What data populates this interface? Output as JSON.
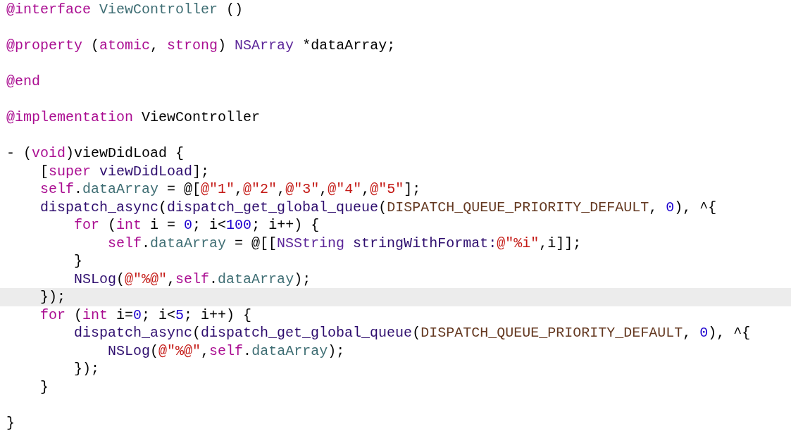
{
  "editor": {
    "lines": [
      {
        "highlighted": false,
        "tokens": [
          {
            "kind": "keyword",
            "text": "@interface"
          },
          {
            "kind": "project",
            "text": " ViewController"
          },
          {
            "kind": "plain",
            "text": " ()"
          }
        ]
      },
      {
        "highlighted": false
      },
      {
        "highlighted": false,
        "tokens": [
          {
            "kind": "keyword",
            "text": "@property"
          },
          {
            "kind": "plain",
            "text": " ("
          },
          {
            "kind": "keyword",
            "text": "atomic"
          },
          {
            "kind": "plain",
            "text": ", "
          },
          {
            "kind": "keyword",
            "text": "strong"
          },
          {
            "kind": "plain",
            "text": ") "
          },
          {
            "kind": "class",
            "text": "NSArray"
          },
          {
            "kind": "plain",
            "text": " *dataArray;"
          }
        ]
      },
      {
        "highlighted": false
      },
      {
        "highlighted": false,
        "tokens": [
          {
            "kind": "keyword",
            "text": "@end"
          }
        ]
      },
      {
        "highlighted": false
      },
      {
        "highlighted": false,
        "tokens": [
          {
            "kind": "keyword",
            "text": "@implementation"
          },
          {
            "kind": "plain",
            "text": " ViewController"
          }
        ]
      },
      {
        "highlighted": false
      },
      {
        "highlighted": false,
        "tokens": [
          {
            "kind": "plain",
            "text": "- ("
          },
          {
            "kind": "keyword",
            "text": "void"
          },
          {
            "kind": "plain",
            "text": ")viewDidLoad {"
          }
        ]
      },
      {
        "highlighted": false,
        "tokens": [
          {
            "kind": "plain",
            "text": "    ["
          },
          {
            "kind": "keyword",
            "text": "super"
          },
          {
            "kind": "system",
            "text": " viewDidLoad"
          },
          {
            "kind": "plain",
            "text": "];"
          }
        ]
      },
      {
        "highlighted": false,
        "tokens": [
          {
            "kind": "keyword",
            "text": "    self"
          },
          {
            "kind": "plain",
            "text": "."
          },
          {
            "kind": "project",
            "text": "dataArray"
          },
          {
            "kind": "plain",
            "text": " = @["
          },
          {
            "kind": "string",
            "text": "@\"1\""
          },
          {
            "kind": "plain",
            "text": ","
          },
          {
            "kind": "string",
            "text": "@\"2\""
          },
          {
            "kind": "plain",
            "text": ","
          },
          {
            "kind": "string",
            "text": "@\"3\""
          },
          {
            "kind": "plain",
            "text": ","
          },
          {
            "kind": "string",
            "text": "@\"4\""
          },
          {
            "kind": "plain",
            "text": ","
          },
          {
            "kind": "string",
            "text": "@\"5\""
          },
          {
            "kind": "plain",
            "text": "];"
          }
        ]
      },
      {
        "highlighted": false,
        "tokens": [
          {
            "kind": "system",
            "text": "    dispatch_async"
          },
          {
            "kind": "plain",
            "text": "("
          },
          {
            "kind": "system",
            "text": "dispatch_get_global_queue"
          },
          {
            "kind": "plain",
            "text": "("
          },
          {
            "kind": "macro",
            "text": "DISPATCH_QUEUE_PRIORITY_DEFAULT"
          },
          {
            "kind": "plain",
            "text": ", "
          },
          {
            "kind": "number",
            "text": "0"
          },
          {
            "kind": "plain",
            "text": "), ^{"
          }
        ]
      },
      {
        "highlighted": false,
        "tokens": [
          {
            "kind": "keyword",
            "text": "        for"
          },
          {
            "kind": "plain",
            "text": " ("
          },
          {
            "kind": "keyword",
            "text": "int"
          },
          {
            "kind": "plain",
            "text": " i = "
          },
          {
            "kind": "number",
            "text": "0"
          },
          {
            "kind": "plain",
            "text": "; i<"
          },
          {
            "kind": "number",
            "text": "100"
          },
          {
            "kind": "plain",
            "text": "; i++) {"
          }
        ]
      },
      {
        "highlighted": false,
        "tokens": [
          {
            "kind": "keyword",
            "text": "            self"
          },
          {
            "kind": "plain",
            "text": "."
          },
          {
            "kind": "project",
            "text": "dataArray"
          },
          {
            "kind": "plain",
            "text": " = @[["
          },
          {
            "kind": "class",
            "text": "NSString"
          },
          {
            "kind": "system",
            "text": " stringWithFormat:"
          },
          {
            "kind": "string",
            "text": "@\"%i\""
          },
          {
            "kind": "plain",
            "text": ",i]];"
          }
        ]
      },
      {
        "highlighted": false,
        "tokens": [
          {
            "kind": "plain",
            "text": "        }"
          }
        ]
      },
      {
        "highlighted": false,
        "tokens": [
          {
            "kind": "system",
            "text": "        NSLog"
          },
          {
            "kind": "plain",
            "text": "("
          },
          {
            "kind": "string",
            "text": "@\"%@\""
          },
          {
            "kind": "plain",
            "text": ","
          },
          {
            "kind": "keyword",
            "text": "self"
          },
          {
            "kind": "plain",
            "text": "."
          },
          {
            "kind": "project",
            "text": "dataArray"
          },
          {
            "kind": "plain",
            "text": ");"
          }
        ]
      },
      {
        "highlighted": true,
        "tokens": [
          {
            "kind": "plain",
            "text": "    });"
          }
        ]
      },
      {
        "highlighted": false,
        "tokens": [
          {
            "kind": "keyword",
            "text": "    for"
          },
          {
            "kind": "plain",
            "text": " ("
          },
          {
            "kind": "keyword",
            "text": "int"
          },
          {
            "kind": "plain",
            "text": " i="
          },
          {
            "kind": "number",
            "text": "0"
          },
          {
            "kind": "plain",
            "text": "; i<"
          },
          {
            "kind": "number",
            "text": "5"
          },
          {
            "kind": "plain",
            "text": "; i++) {"
          }
        ]
      },
      {
        "highlighted": false,
        "tokens": [
          {
            "kind": "system",
            "text": "        dispatch_async"
          },
          {
            "kind": "plain",
            "text": "("
          },
          {
            "kind": "system",
            "text": "dispatch_get_global_queue"
          },
          {
            "kind": "plain",
            "text": "("
          },
          {
            "kind": "macro",
            "text": "DISPATCH_QUEUE_PRIORITY_DEFAULT"
          },
          {
            "kind": "plain",
            "text": ", "
          },
          {
            "kind": "number",
            "text": "0"
          },
          {
            "kind": "plain",
            "text": "), ^{"
          }
        ]
      },
      {
        "highlighted": false,
        "tokens": [
          {
            "kind": "system",
            "text": "            NSLog"
          },
          {
            "kind": "plain",
            "text": "("
          },
          {
            "kind": "string",
            "text": "@\"%@\""
          },
          {
            "kind": "plain",
            "text": ","
          },
          {
            "kind": "keyword",
            "text": "self"
          },
          {
            "kind": "plain",
            "text": "."
          },
          {
            "kind": "project",
            "text": "dataArray"
          },
          {
            "kind": "plain",
            "text": ");"
          }
        ]
      },
      {
        "highlighted": false,
        "tokens": [
          {
            "kind": "plain",
            "text": "        });"
          }
        ]
      },
      {
        "highlighted": false,
        "tokens": [
          {
            "kind": "plain",
            "text": "    }"
          }
        ]
      },
      {
        "highlighted": false
      },
      {
        "highlighted": false,
        "tokens": [
          {
            "kind": "plain",
            "text": "}"
          }
        ]
      }
    ]
  }
}
